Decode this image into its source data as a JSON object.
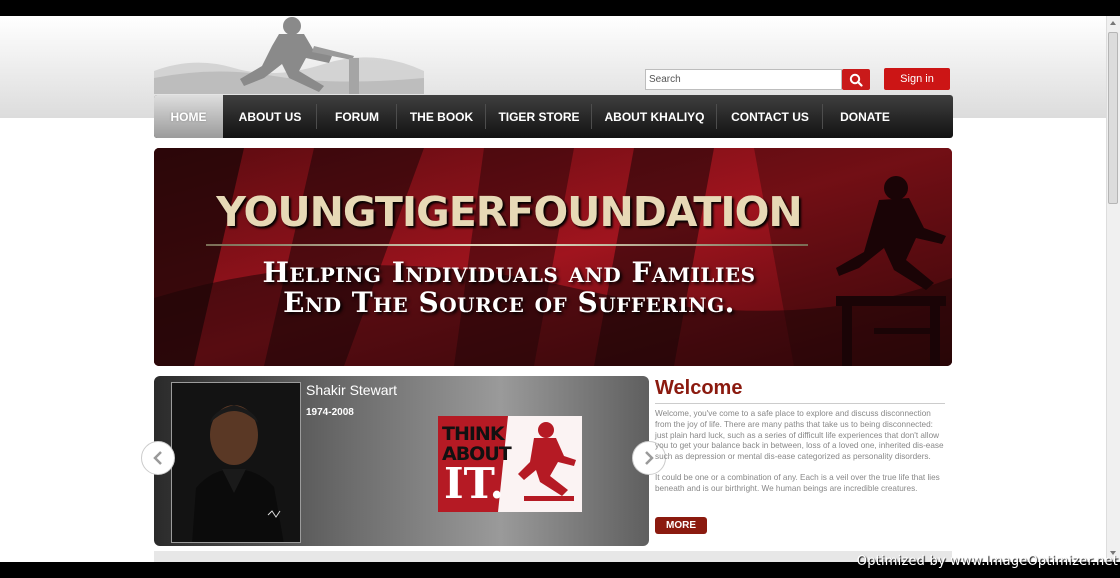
{
  "header": {
    "search_placeholder": "Search",
    "signin_label": "Sign in"
  },
  "nav": {
    "items": [
      {
        "label": "HOME"
      },
      {
        "label": "ABOUT US"
      },
      {
        "label": "FORUM"
      },
      {
        "label": "THE BOOK"
      },
      {
        "label": "TIGER STORE"
      },
      {
        "label": "ABOUT KHALIYQ"
      },
      {
        "label": "CONTACT US"
      },
      {
        "label": "DONATE"
      }
    ]
  },
  "hero": {
    "title": "YOUNGTIGERFOUNDATION",
    "subtitle_line1": "Helping Individuals and Families",
    "subtitle_line2": "End The Source of Suffering."
  },
  "slider": {
    "name": "Shakir Stewart",
    "years": "1974-2008",
    "think_line1": "THINK",
    "think_line2": "ABOUT",
    "think_line3": "IT."
  },
  "welcome": {
    "title": "Welcome",
    "paragraph1": "Welcome, you've come to a safe place to explore and discuss disconnection from the joy of life. There are many paths that take us to being disconnected: just plain hard luck, such as a series of difficult life experiences that don't allow you to get your balance back in between, loss of a loved one, inherited dis-ease such as depression or mental dis-ease categorized as personality disorders.",
    "paragraph2": "It could be one or a combination of any. Each is a veil over the true life that lies beneath and is our birthright. We human beings are incredible creatures.",
    "more_label": "MORE"
  },
  "watermark": {
    "text": "Optimized by www.ImageOptimizer.net"
  },
  "colors": {
    "accent_red": "#cc1515",
    "welcome_red": "#8b1a0f",
    "nav_dark": "#1e1e1e"
  },
  "icons": {
    "search": "search-icon",
    "prev": "chevron-left-icon",
    "next": "chevron-right-icon"
  }
}
